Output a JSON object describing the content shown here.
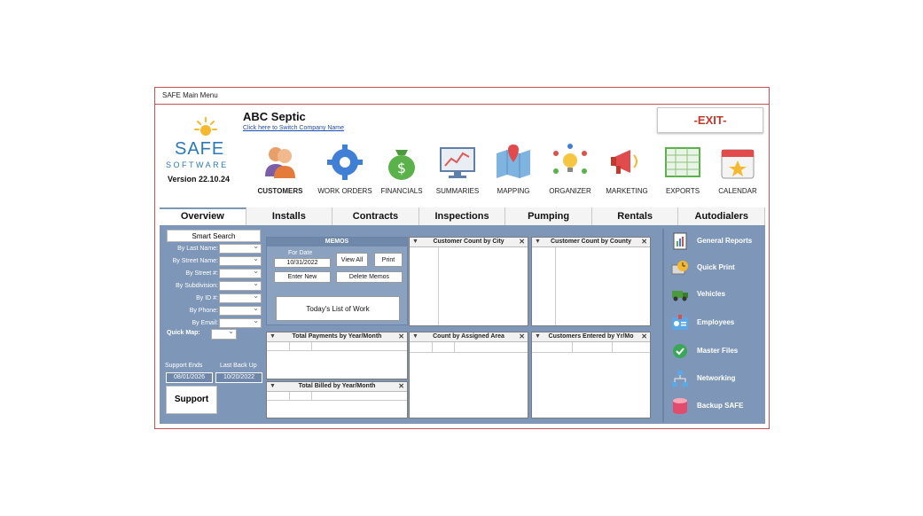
{
  "window": {
    "title": "SAFE Main Menu"
  },
  "header": {
    "logo_safe": "SAFE",
    "logo_software": "SOFTWARE",
    "version": "Version 22.10.24",
    "company_name": "ABC Septic",
    "switch_company_link": "Click here to Switch Company Name",
    "exit_label": "-EXIT-"
  },
  "nav": [
    {
      "label": "CUSTOMERS",
      "icon": "customers-icon"
    },
    {
      "label": "WORK ORDERS",
      "icon": "gear-icon"
    },
    {
      "label": "FINANCIALS",
      "icon": "money-bag-icon"
    },
    {
      "label": "SUMMARIES",
      "icon": "dashboard-icon"
    },
    {
      "label": "MAPPING",
      "icon": "map-icon"
    },
    {
      "label": "ORGANIZER",
      "icon": "lightbulb-icon"
    },
    {
      "label": "MARKETING",
      "icon": "megaphone-icon"
    },
    {
      "label": "EXPORTS",
      "icon": "spreadsheet-icon"
    },
    {
      "label": "CALENDAR",
      "icon": "calendar-icon"
    }
  ],
  "tabs": [
    "Overview",
    "Installs",
    "Contracts",
    "Inspections",
    "Pumping",
    "Rentals",
    "Autodialers"
  ],
  "search": {
    "smart_search": "Smart Search",
    "fields": [
      "By Last Name:",
      "By Street Name:",
      "By Street #:",
      "By Subdivision:",
      "By ID #:",
      "By Phone:",
      "By Email:"
    ],
    "quick_map": "Quick Map:"
  },
  "support": {
    "support_ends_label": "Support Ends",
    "support_ends_value": "08/01/2026",
    "last_backup_label": "Last Back Up",
    "last_backup_value": "10/20/2022",
    "support_button": "Support"
  },
  "memos": {
    "title": "MEMOS",
    "for_date_label": "For Date",
    "date": "10/31/2022",
    "view_all": "View All",
    "print": "Print",
    "enter_new": "Enter New",
    "delete_memos": "Delete Memos",
    "todays_work": "Today's List of Work"
  },
  "boxes": {
    "customer_count_city": "Customer Count by City",
    "customer_count_county": "Customer Count by County",
    "total_payments": "Total Payments by Year/Month",
    "total_billed": "Total Billed by Year/Month",
    "count_assigned_area": "Count by Assigned Area",
    "customers_entered": "Customers Entered by Yr/Mo"
  },
  "right_menu": [
    {
      "label": "General Reports",
      "icon": "report-icon"
    },
    {
      "label": "Quick Print",
      "icon": "clock-print-icon"
    },
    {
      "label": "Vehicles",
      "icon": "truck-icon"
    },
    {
      "label": "Employees",
      "icon": "id-badge-icon"
    },
    {
      "label": "Master Files",
      "icon": "shield-check-icon"
    },
    {
      "label": "Networking",
      "icon": "network-icon"
    },
    {
      "label": "Backup SAFE",
      "icon": "database-icon"
    }
  ],
  "colors": {
    "panel": "#7e97b8",
    "exit_red": "#c0392b",
    "brand_blue": "#2b79b9",
    "window_border": "#c9514f"
  }
}
